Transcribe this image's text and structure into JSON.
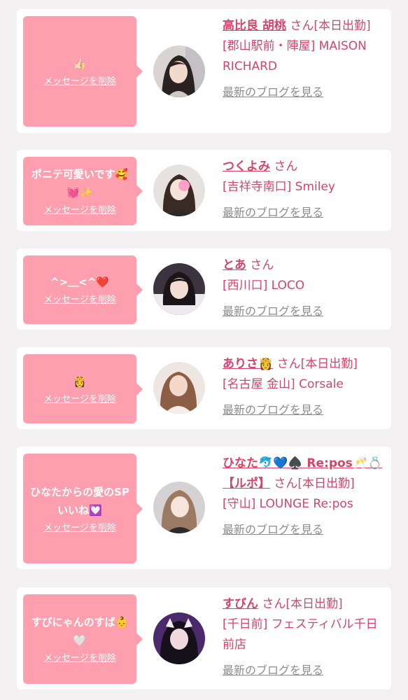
{
  "colors": {
    "accent": "#d8436a",
    "bubble": "#fd9fae",
    "background": "#f3f1f2",
    "card": "#ffffff",
    "link_gray": "#8d8d8d"
  },
  "delete_label": "メッセージを削除",
  "blog_label": "最新のブログを見る",
  "san_label": "さん",
  "messages": [
    {
      "message": "👍🏻",
      "name": "高比良 胡桃",
      "status": "[本日出勤]",
      "shop": "[郡山駅前・陣屋] MAISON RICHARD",
      "avatar_icon": "avatar-photo"
    },
    {
      "message": "ポニテ可愛いです🥰💓✨",
      "name": "つくよみ",
      "status": "",
      "shop": "[吉祥寺南口] Smiley",
      "avatar_icon": "avatar-photo"
    },
    {
      "message": "^>﹏<^❤️",
      "name": "とあ",
      "status": "",
      "shop": "[西川口] LOCO",
      "avatar_icon": "avatar-photo"
    },
    {
      "message": "👸",
      "name": "ありさ👸",
      "status": "[本日出勤]",
      "shop": "[名古屋 金山] Corsale",
      "avatar_icon": "avatar-photo"
    },
    {
      "message": "ひなたからの愛のSPいいね💟",
      "name": "ひなた🐬💙♠️ Re:pos🥂💍【ルポ】",
      "status": "[本日出勤]",
      "shop": "[守山] LOUNGE Re:pos",
      "avatar_icon": "avatar-photo"
    },
    {
      "message": "すびにゃんのすば👶🤍",
      "name": "すびん",
      "status": "[本日出勤]",
      "shop": "[千日前] フェスティバル千日前店",
      "avatar_icon": "avatar-photo"
    }
  ]
}
